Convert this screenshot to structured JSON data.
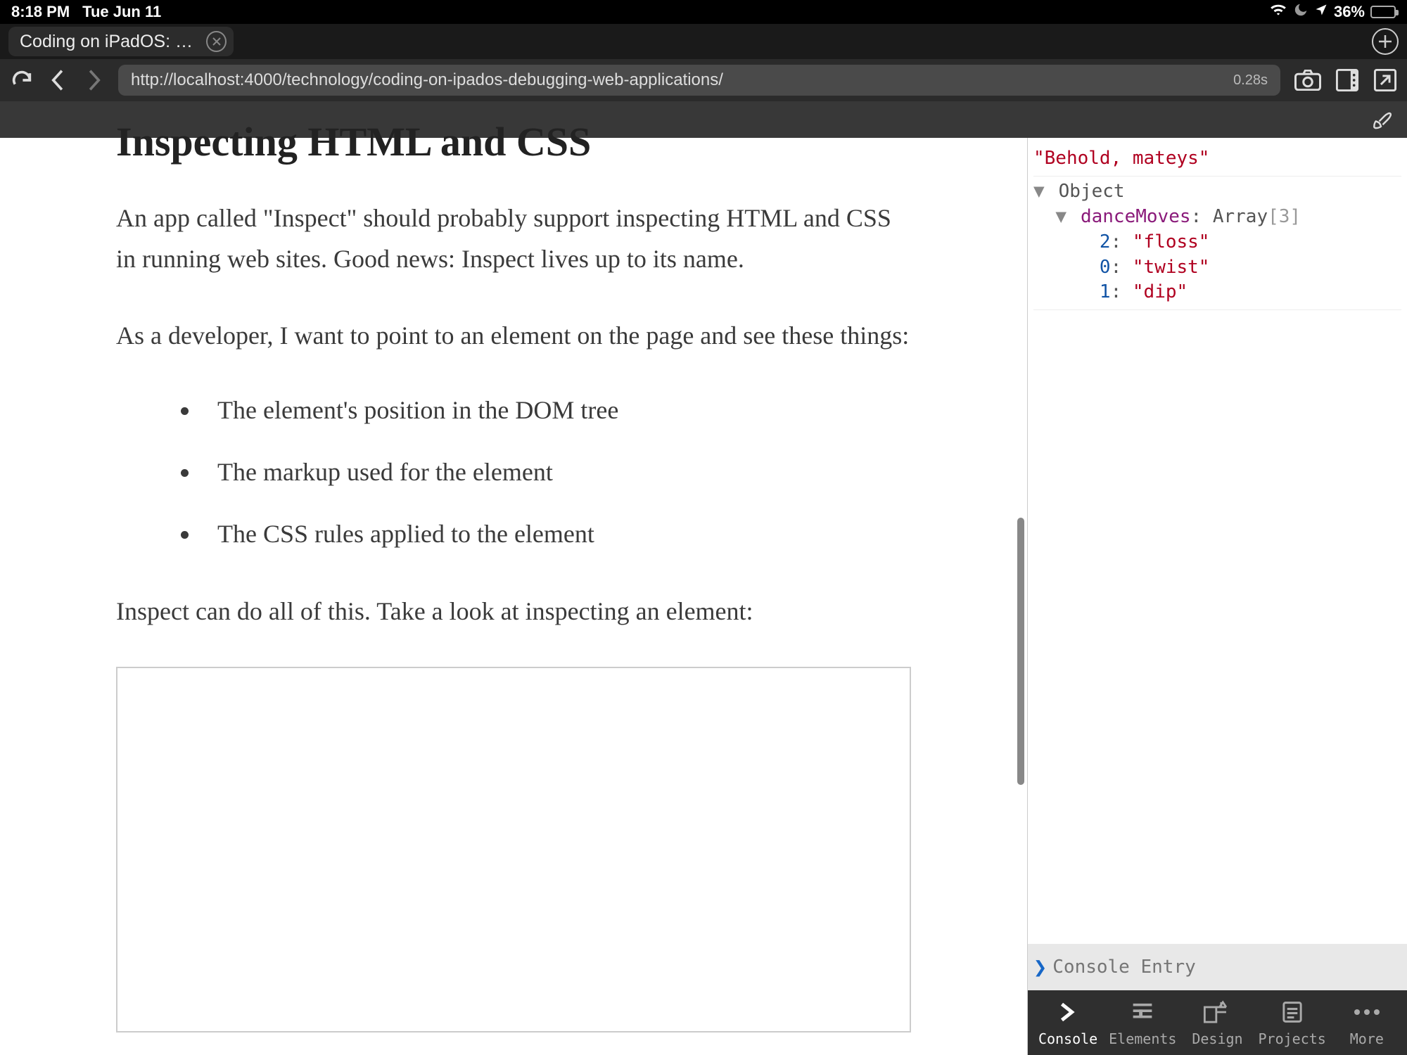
{
  "status": {
    "time": "8:18 PM",
    "date": "Tue Jun 11",
    "battery_pct": "36%",
    "battery_fill": 36
  },
  "tabs": {
    "active_title": "Coding on iPadOS: D…"
  },
  "toolbar": {
    "url": "http://localhost:4000/technology/coding-on-ipados-debugging-web-applications/",
    "load_time": "0.28s"
  },
  "article": {
    "heading": "Inspecting HTML and CSS",
    "p1": "An app called \"Inspect\" should probably support inspecting HTML and CSS in running web sites. Good news: Inspect lives up to its name.",
    "p2": "As a developer, I want to point to an element on the page and see these things:",
    "li1": "The element's position in the DOM tree",
    "li2": "The markup used for the element",
    "li3": "The CSS rules applied to the element",
    "p3": "Inspect can do all of this. Take a look at inspecting an element:"
  },
  "console": {
    "line1": "\"Behold, mateys\"",
    "obj_label": "Object",
    "prop_name": "danceMoves",
    "prop_type": "Array",
    "prop_len": "[3]",
    "items": [
      {
        "idx": "2",
        "val": "\"floss\""
      },
      {
        "idx": "0",
        "val": "\"twist\""
      },
      {
        "idx": "1",
        "val": "\"dip\""
      }
    ],
    "entry_placeholder": "Console Entry"
  },
  "devtabs": {
    "console": "Console",
    "elements": "Elements",
    "design": "Design",
    "projects": "Projects",
    "more": "More"
  }
}
